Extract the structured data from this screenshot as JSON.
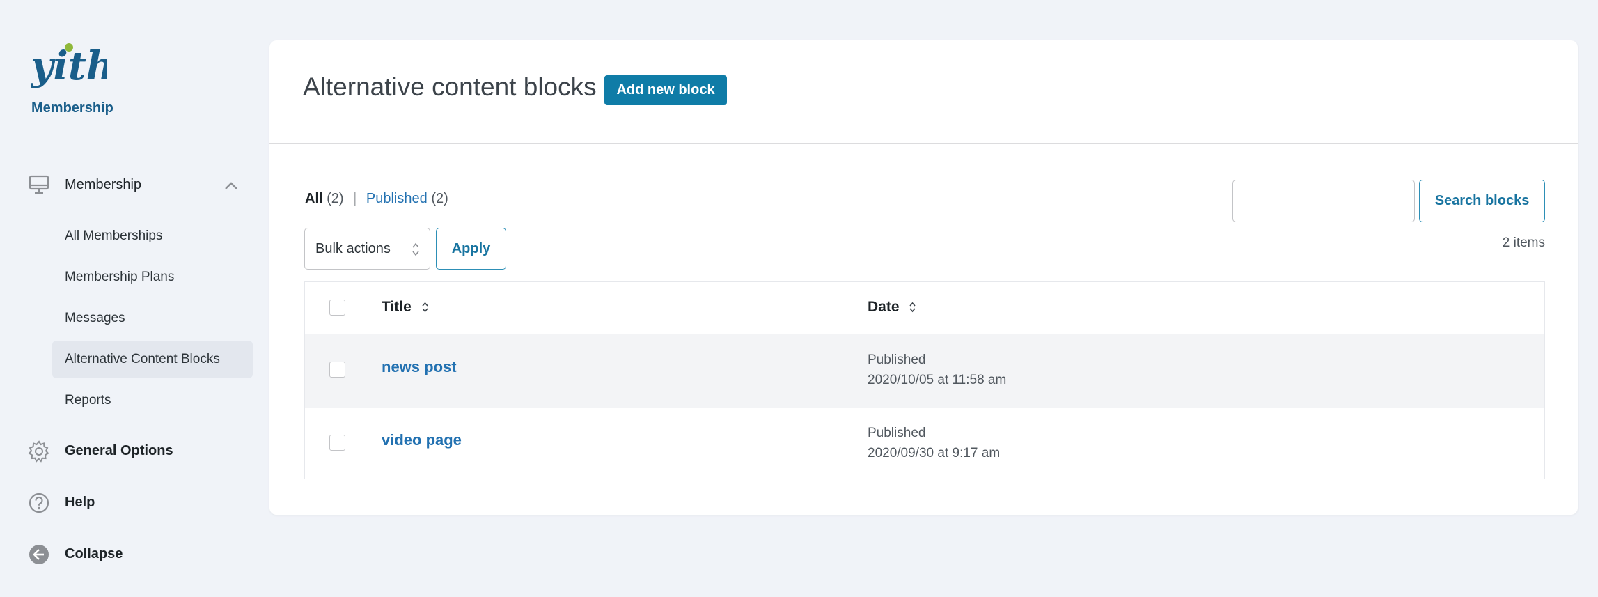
{
  "sidebar": {
    "brand": "Membership",
    "nav": {
      "membership_label": "Membership",
      "general_label": "General Options",
      "help_label": "Help",
      "collapse_label": "Collapse"
    },
    "subitems": [
      {
        "label": "All Memberships"
      },
      {
        "label": "Membership Plans"
      },
      {
        "label": "Messages"
      },
      {
        "label": "Alternative Content Blocks",
        "active": true
      },
      {
        "label": "Reports"
      }
    ]
  },
  "header": {
    "title": "Alternative content blocks",
    "add_button": "Add new block"
  },
  "filters": {
    "all_label": "All",
    "all_count": "(2)",
    "separator": "|",
    "published_label": "Published",
    "published_count": "(2)"
  },
  "search": {
    "placeholder": "",
    "button": "Search blocks"
  },
  "items_count": "2 items",
  "bulk": {
    "selected": "Bulk actions",
    "apply": "Apply"
  },
  "table": {
    "columns": {
      "title": "Title",
      "date": "Date"
    },
    "rows": [
      {
        "title": "news post",
        "status": "Published",
        "date": "2020/10/05 at 11:58 am"
      },
      {
        "title": "video page",
        "status": "Published",
        "date": "2020/09/30 at 9:17 am"
      }
    ]
  },
  "colors": {
    "accent": "#0f7ca7",
    "link": "#2271b1",
    "brand_text": "#1a5e8a",
    "logo_green": "#8fb83a",
    "background": "#f0f3f8"
  },
  "icons": {
    "logo": "yith-logo",
    "membership": "monitor-icon",
    "general": "gear-icon",
    "help": "question-circle-icon",
    "collapse": "arrow-left-circle-icon"
  }
}
